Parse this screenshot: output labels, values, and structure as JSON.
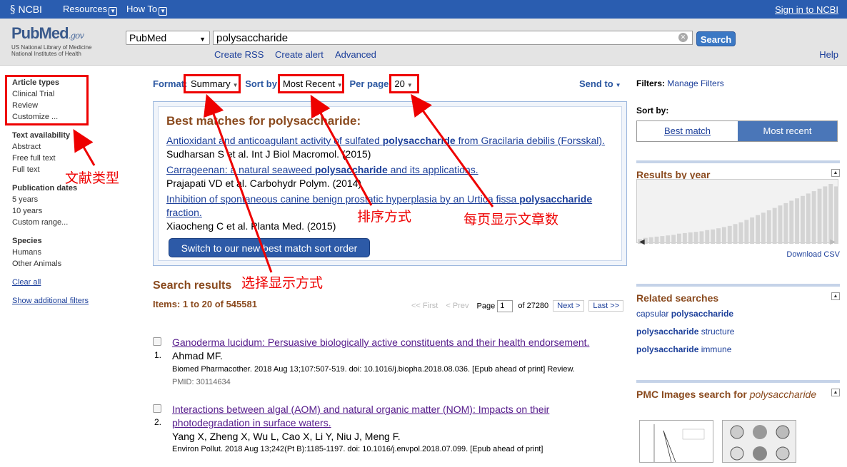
{
  "topbar": {
    "logo": "NCBI",
    "resources": "Resources",
    "howto": "How To",
    "signin": "Sign in to NCBI"
  },
  "header": {
    "brand": "PubMed",
    "brand_suffix": ".gov",
    "brand_sub1": "US National Library of Medicine",
    "brand_sub2": "National Institutes of Health",
    "db": "PubMed",
    "query": "polysaccharide",
    "search_btn": "Search",
    "links": [
      "Create RSS",
      "Create alert",
      "Advanced"
    ],
    "help": "Help"
  },
  "left": {
    "groups": [
      {
        "title": "Article types",
        "items": [
          "Clinical Trial",
          "Review",
          "Customize ..."
        ]
      },
      {
        "title": "Text availability",
        "items": [
          "Abstract",
          "Free full text",
          "Full text"
        ]
      },
      {
        "title": "Publication dates",
        "items": [
          "5 years",
          "10 years",
          "Custom range..."
        ]
      },
      {
        "title": "Species",
        "items": [
          "Humans",
          "Other Animals"
        ]
      }
    ],
    "clear": "Clear all",
    "show": "Show additional filters"
  },
  "bar": {
    "format_label": "Format:",
    "format": "Summary",
    "sort_label": "Sort by:",
    "sort": "Most Recent",
    "per_label": "Per page:",
    "per": "20",
    "sendto": "Send to"
  },
  "best": {
    "heading": "Best matches for polysaccharide:",
    "items": [
      {
        "pre": "Antioxidant and anticoagulant activity of sulfated ",
        "kw": "polysaccharide",
        "post": " from Gracilaria debilis (Forsskal).",
        "cite": "Sudharsan S et al. Int J Biol Macromol. (2015)"
      },
      {
        "pre": "Carrageenan: a natural seaweed ",
        "kw": "polysaccharide",
        "post": " and its applications.",
        "cite": "Prajapati VD et al. Carbohydr Polym. (2014)"
      },
      {
        "pre": "Inhibition of spontaneous canine benign prostatic hyperplasia by an Urtica fissa ",
        "kw": "polysaccharide",
        "post": " fraction.",
        "cite": "Xiaocheng C et al. Planta Med. (2015)"
      }
    ],
    "button": "Switch to our new best match sort order"
  },
  "results": {
    "heading": "Search results",
    "items": "Items: 1 to 20 of 545581",
    "pager": {
      "first": "<< First",
      "prev": "< Prev",
      "page_label": "Page",
      "page": "1",
      "of": "of 27280",
      "next": "Next >",
      "last": "Last >>"
    },
    "list": [
      {
        "num": "1.",
        "title": "Ganoderma lucidum: Persuasive biologically active constituents and their health endorsement.",
        "authors": "Ahmad MF.",
        "source": "Biomed Pharmacother. 2018 Aug 13;107:507-519. doi: 10.1016/j.biopha.2018.08.036. [Epub ahead of print] Review.",
        "pmid": "PMID: 30114634"
      },
      {
        "num": "2.",
        "title": "Interactions between algal (AOM) and natural organic matter (NOM): Impacts on their photodegradation in surface waters.",
        "authors": "Yang X, Zheng X, Wu L, Cao X, Li Y, Niu J, Meng F.",
        "source": "Environ Pollut. 2018 Aug 13;242(Pt B):1185-1197. doi: 10.1016/j.envpol.2018.07.099. [Epub ahead of print]"
      }
    ]
  },
  "right": {
    "filters_label": "Filters:",
    "manage": "Manage Filters",
    "sortby": "Sort by:",
    "sort_a": "Best match",
    "sort_b": "Most recent",
    "ryear": "Results by year",
    "csv": "Download CSV",
    "year_counts": [
      8,
      10,
      11,
      12,
      13,
      14,
      15,
      17,
      18,
      19,
      20,
      21,
      23,
      24,
      26,
      28,
      30,
      33,
      36,
      40,
      44,
      48,
      52,
      56,
      60,
      64,
      68,
      72,
      76,
      80,
      84,
      88,
      92,
      96,
      100,
      96
    ],
    "related": "Related searches",
    "related_items": [
      {
        "pre": "capsular ",
        "kw": "polysaccharide",
        "post": ""
      },
      {
        "pre": "",
        "kw": "polysaccharide",
        "post": " structure"
      },
      {
        "pre": "",
        "kw": "polysaccharide",
        "post": " immune"
      }
    ],
    "pmc_pre": "PMC Images search for ",
    "pmc_kw": "polysaccharide"
  },
  "annotations": {
    "a1": "文献类型",
    "a2": "排序方式",
    "a3": "每页显示文章数",
    "a4": "选择显示方式"
  }
}
